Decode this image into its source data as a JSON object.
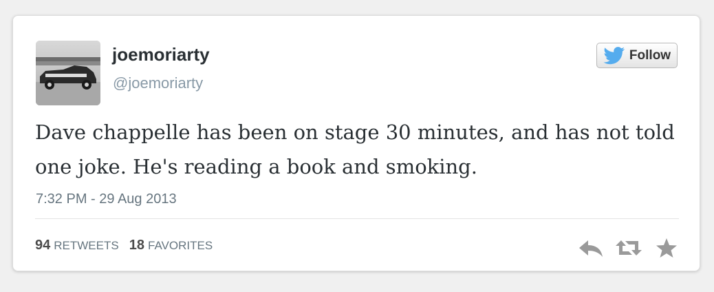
{
  "user": {
    "display_name": "joemoriarty",
    "handle": "@joemoriarty",
    "avatar_icon": "vintage-car-photo"
  },
  "follow_button": {
    "label": "Follow",
    "icon": "twitter-bird-icon",
    "bird_color": "#55acee"
  },
  "tweet": {
    "text": "Dave chappelle has been on stage 30 minutes, and has not told one joke. He's reading a book and smoking.",
    "timestamp": "7:32 PM - 29 Aug 2013"
  },
  "stats": {
    "retweets_count": "94",
    "retweets_label": "RETWEETS",
    "favorites_count": "18",
    "favorites_label": "FAVORITES"
  },
  "actions": [
    {
      "name": "reply",
      "icon": "reply-icon"
    },
    {
      "name": "retweet",
      "icon": "retweet-icon"
    },
    {
      "name": "favorite",
      "icon": "star-icon"
    }
  ],
  "colors": {
    "icon_gray": "#9a9a9a",
    "text_primary": "#292f33",
    "text_secondary": "#66757f"
  }
}
